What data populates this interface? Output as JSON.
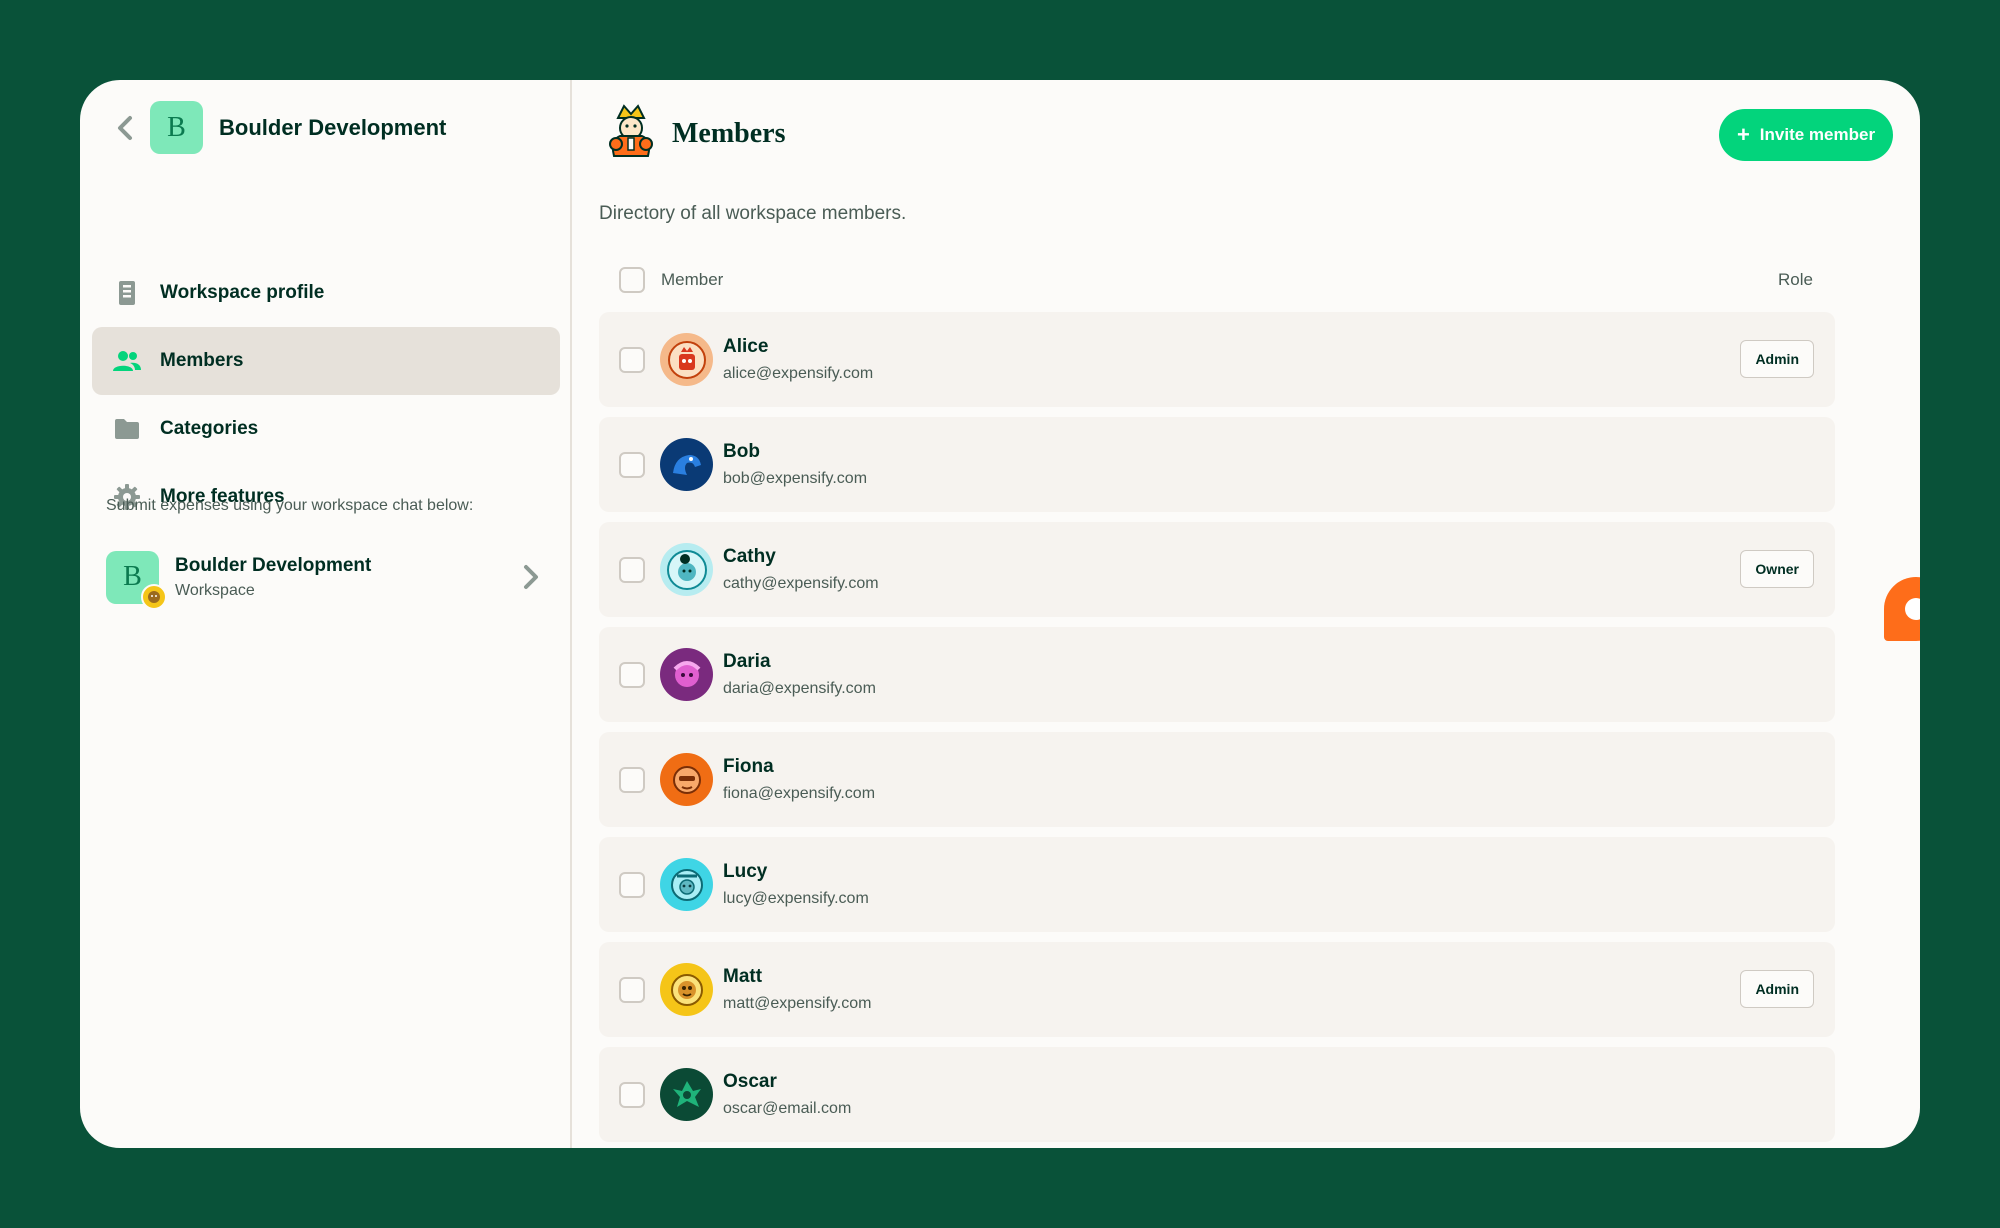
{
  "sidebar": {
    "workspace_initial": "B",
    "workspace_name": "Boulder Development",
    "nav_items": [
      {
        "label": "Workspace profile",
        "icon": "building-icon",
        "active": false
      },
      {
        "label": "Members",
        "icon": "users-icon",
        "active": true
      },
      {
        "label": "Categories",
        "icon": "folder-icon",
        "active": false
      },
      {
        "label": "More features",
        "icon": "gear-icon",
        "active": false
      }
    ],
    "chat_hint": "Submit expenses using your workspace chat below:",
    "chat": {
      "initial": "B",
      "title": "Boulder Development",
      "subtitle": "Workspace"
    }
  },
  "main": {
    "title": "Members",
    "invite_label": "Invite member",
    "description": "Directory of all workspace members.",
    "columns": {
      "member": "Member",
      "role": "Role"
    },
    "members": [
      {
        "name": "Alice",
        "email": "alice@expensify.com",
        "role": "Admin",
        "avatar_color": "#f5b98a"
      },
      {
        "name": "Bob",
        "email": "bob@expensify.com",
        "role": "",
        "avatar_color": "#0a3a75"
      },
      {
        "name": "Cathy",
        "email": "cathy@expensify.com",
        "role": "Owner",
        "avatar_color": "#b7ecf0"
      },
      {
        "name": "Daria",
        "email": "daria@expensify.com",
        "role": "",
        "avatar_color": "#7a2a7e"
      },
      {
        "name": "Fiona",
        "email": "fiona@expensify.com",
        "role": "",
        "avatar_color": "#f06d14"
      },
      {
        "name": "Lucy",
        "email": "lucy@expensify.com",
        "role": "",
        "avatar_color": "#3fd5e5"
      },
      {
        "name": "Matt",
        "email": "matt@expensify.com",
        "role": "Admin",
        "avatar_color": "#f5c518"
      },
      {
        "name": "Oscar",
        "email": "oscar@email.com",
        "role": "",
        "avatar_color": "#0b4a35"
      }
    ]
  },
  "colors": {
    "accent": "#03d47c",
    "background": "#095239",
    "fab": "#fe6d1a"
  }
}
